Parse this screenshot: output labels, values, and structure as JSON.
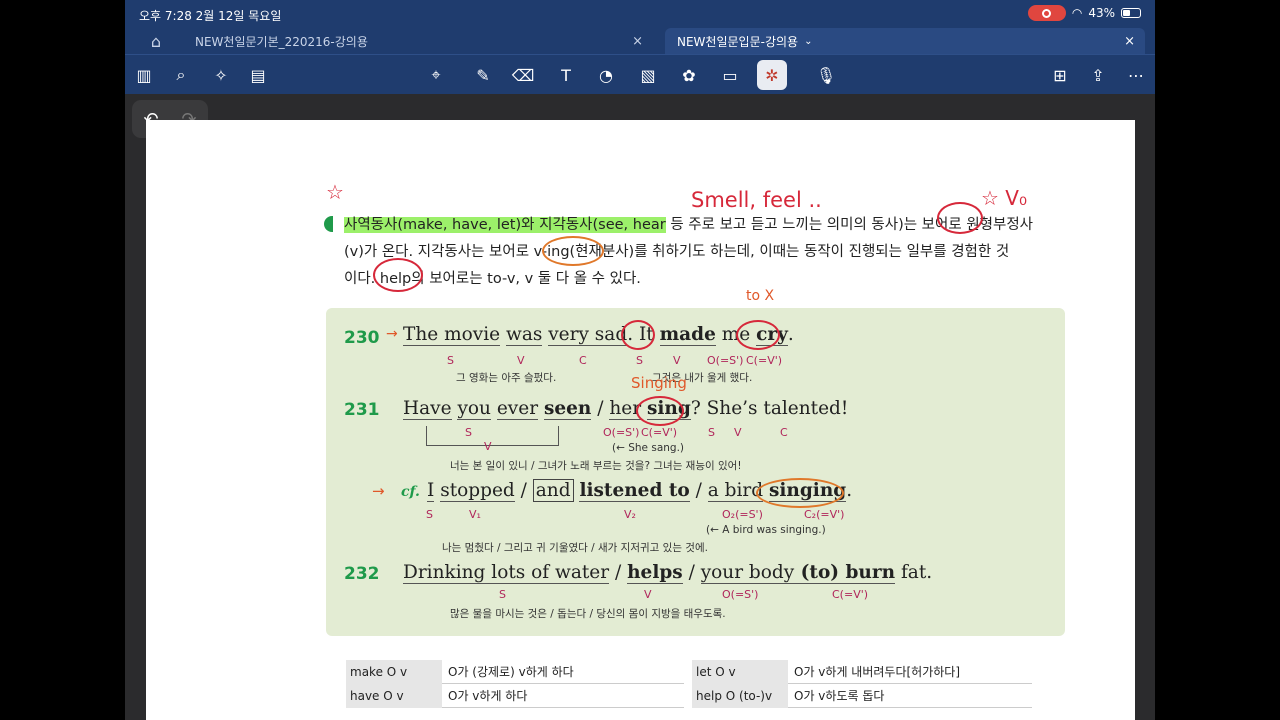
{
  "status": {
    "time": "오후 7:28   2월 12일 목요일",
    "battery": "43%"
  },
  "tabs": [
    {
      "label": "NEW천일문기본_220216-강의용"
    },
    {
      "label": "NEW천일문입문-강의용"
    }
  ],
  "toolbar_icons": [
    "sidebar-icon",
    "search-icon",
    "sparkle-icon",
    "document-icon",
    "lasso-icon",
    "pen-icon",
    "eraser-icon",
    "text-icon",
    "shape-icon",
    "image-icon",
    "stickers-icon",
    "note-icon",
    "laser-pointer-icon",
    "mic-icon",
    "add-page-icon",
    "share-icon",
    "more-icon"
  ],
  "para": {
    "l1a": "사역동사",
    "l1b": "(make, have, let)와 ",
    "l1c": "지각동사",
    "l1d": "(see, hear",
    "l1e": " 등 주로 보고 듣고 느끼는 의미의 동사)는 보어로 원형부정사",
    "l2": "(v)가 온다. 지각동사는 보어로 v-ing(현재분사)를 취하기도 하는데, 이때는 동작이 진행되는 일부를 경험한 것",
    "l3": "이다. help의 보어로는 to-v, v 둘 다 올 수 있다."
  },
  "s230": {
    "num": "230",
    "a": "The movie",
    "b": "was",
    "c": "very sad",
    "d": ". It ",
    "e": "made",
    "f": " me ",
    "g": "cry",
    "h": ".",
    "labels": [
      "S",
      "V",
      "C",
      "S",
      "V",
      "O(=S')",
      "C(=V')"
    ],
    "kr1": "그 영화는 아주 슬펐다.",
    "kr2": "그것은 내가 울게 했다."
  },
  "s231": {
    "num": "231",
    "a": "Have",
    "b": "you",
    "c": "ever",
    "d": "seen",
    "e": " / ",
    "f": "her",
    "g": "sing",
    "h": "? ",
    "i": "She’s talented!",
    "labels": [
      "S",
      "V",
      "O(=S')",
      "C(=V')",
      "S",
      "V",
      "C"
    ],
    "note": "(← She sang.)",
    "kr": "너는 본 일이 있니          /   그녀가 노래 부르는 것을?  그녀는 재능이 있어!"
  },
  "cf": {
    "label": "cf.",
    "a": "I",
    "b": "stopped",
    "c": " / ",
    "d": "and",
    "e": "listened to",
    "f": " / ",
    "g": "a bird",
    "h": "singing",
    "i": ".",
    "labels": [
      "S",
      "V₁",
      "V₂",
      "O₂(=S')",
      "C₂(=V')"
    ],
    "note": "(← A bird was singing.)",
    "kr": "나는 멈췄다      /          그리고 귀 기울였다          /     새가 지저귀고 있는 것에."
  },
  "s232": {
    "num": "232",
    "a": "Drinking lots of water",
    "b": " / ",
    "c": "helps",
    "d": " / ",
    "e": "your body",
    "f": " (to) burn",
    "g": " fat.",
    "labels": [
      "S",
      "V",
      "O(=S')",
      "C(=V')"
    ],
    "kr": "많은 물을 마시는 것은               /       돕는다     /             당신의 몸이 지방을 태우도록."
  },
  "ink": {
    "smell": "Smell, feel ..",
    "vo": "☆  V₀",
    "tox": "to X",
    "singing": "Singing",
    "star": "☆"
  },
  "table_left": [
    {
      "k": "make O v",
      "v": "O가 (강제로) v하게 하다"
    },
    {
      "k": "have O v",
      "v": "O가 v하게 하다"
    }
  ],
  "table_right": [
    {
      "k": "let O v",
      "v": "O가 v하게 내버려두다[허가하다]"
    },
    {
      "k": "help O (to-)v",
      "v": "O가 v하도록 돕다"
    }
  ]
}
